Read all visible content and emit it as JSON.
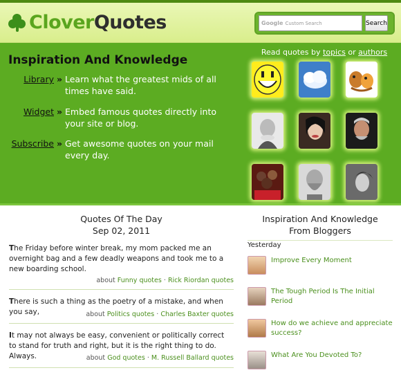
{
  "header": {
    "logo_part1": "Clover",
    "logo_part2": "Quotes",
    "search_placeholder": "Custom Search",
    "search_google": "Google",
    "search_button": "Search"
  },
  "hero": {
    "title": "Inspiration And Knowledge",
    "features": [
      {
        "name": "Library",
        "desc": "Learn what the greatest mids of all times have said."
      },
      {
        "name": "Widget",
        "desc": "Embed famous quotes directly into your site or blog."
      },
      {
        "name": "Subscribe",
        "desc": "Get awesome quotes on your mail every day."
      }
    ],
    "topics_prefix": "Read quotes by",
    "topics_link": "topics",
    "topics_or": "or",
    "authors_link": "authors"
  },
  "qotd": {
    "title": "Quotes Of The Day",
    "date": "Sep 02, 2011",
    "quotes": [
      {
        "first": "T",
        "rest": "he Friday before winter break, my mom packed me an overnight bag and a few deadly weapons and took me to a new boarding school.",
        "topic": "Funny quotes",
        "author": "Rick Riordan quotes"
      },
      {
        "first": "T",
        "rest": "here is such a thing as the poetry of a mistake, and when you say,",
        "topic": "Politics quotes",
        "author": "Charles Baxter quotes"
      },
      {
        "first": "I",
        "rest": "t may not always be easy, convenient or politically correct to stand for truth and right, but it is the right thing to do. Always.",
        "topic": "God quotes",
        "author": "M. Russell Ballard quotes"
      }
    ],
    "about": "about",
    "dot": "·"
  },
  "bloggers": {
    "title_line1": "Inspiration And Knowledge",
    "title_line2": "From Bloggers",
    "yesterday": "Yesterday",
    "posts": [
      {
        "title": "Improve Every Moment"
      },
      {
        "title": "The Tough Period Is The Initial Period"
      },
      {
        "title": "How do we achieve and appreciate success?"
      },
      {
        "title": "What Are You Devoted To?"
      }
    ]
  },
  "colors": {
    "brand_green": "#5cac22",
    "link_green": "#4a8f1c",
    "header_bg": "#e0f3a0"
  }
}
